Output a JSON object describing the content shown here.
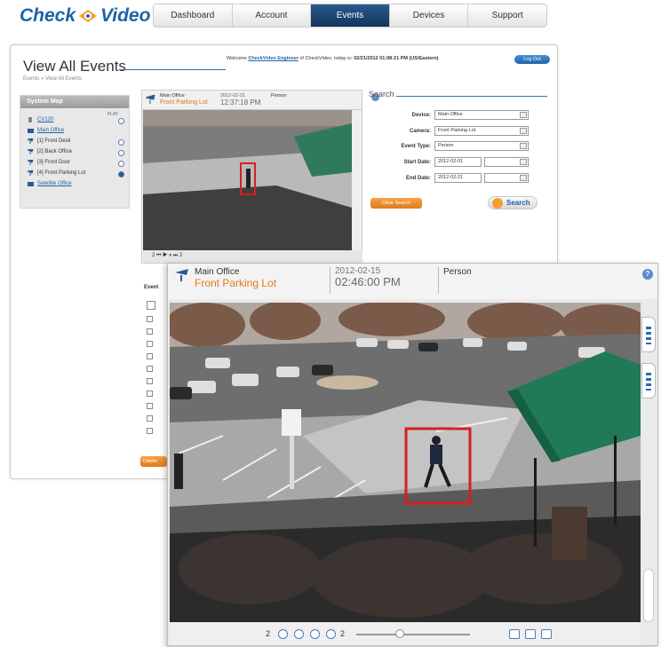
{
  "header": {
    "logo_left": "Check",
    "logo_right": "Video",
    "nav": [
      "Dashboard",
      "Account",
      "Events",
      "Devices",
      "Support"
    ],
    "active_nav": "Events"
  },
  "page": {
    "title": "View All Events",
    "breadcrumb": "Events » View All Events",
    "welcome_prefix": "Welcome",
    "welcome_user": "CheckVideo Engineer",
    "welcome_middle": "of CheckVideo, today is:",
    "welcome_datetime": "02/21/2012 01:08:21 PM (US/Eastern)",
    "logout_label": "Log Out"
  },
  "system_map": {
    "title": "System Map",
    "play_label": "PLAY",
    "items": [
      {
        "label": "CV120",
        "type": "device"
      },
      {
        "label": "Main Office",
        "type": "site"
      },
      {
        "label": "[1] Front Desk",
        "type": "camera"
      },
      {
        "label": "[2] Back Office",
        "type": "camera"
      },
      {
        "label": "[3] Front Door",
        "type": "camera"
      },
      {
        "label": "[4] Front Parking Lot",
        "type": "camera"
      },
      {
        "label": "Satellite Office",
        "type": "site"
      }
    ]
  },
  "small_camera": {
    "location": "Main Office",
    "camera": "Front Parking Lot",
    "date": "2012-02-21",
    "time": "12:37:18 PM",
    "type": "Person",
    "controls": "2 ⏮ ▶ ⏸ ⏭ 2"
  },
  "search": {
    "title": "Search",
    "fields": [
      {
        "label": "Device:",
        "value": "Main Office"
      },
      {
        "label": "Camera:",
        "value": "Front Parking Lot"
      },
      {
        "label": "Event Type:",
        "value": "Person"
      },
      {
        "label": "Start Date:",
        "value": "2012-02-01"
      },
      {
        "label": "End Date:",
        "value": "2012-02-21"
      }
    ],
    "clear_label": "Clear Search",
    "search_label": "Search"
  },
  "events": {
    "column": "Event",
    "delete_label": "Delete"
  },
  "big_camera": {
    "location": "Main Office",
    "camera": "Front Parking Lot",
    "date": "2012-02-15",
    "time": "02:46:00 PM",
    "type": "Person",
    "help": "?",
    "frame_start": "2",
    "frame_end": "2",
    "slider_position": 0.38
  },
  "colors": {
    "brand_blue": "#1d64a8",
    "orange": "#e07a1a",
    "nav_active": "#12345c",
    "detection_box": "#d81e1e"
  }
}
